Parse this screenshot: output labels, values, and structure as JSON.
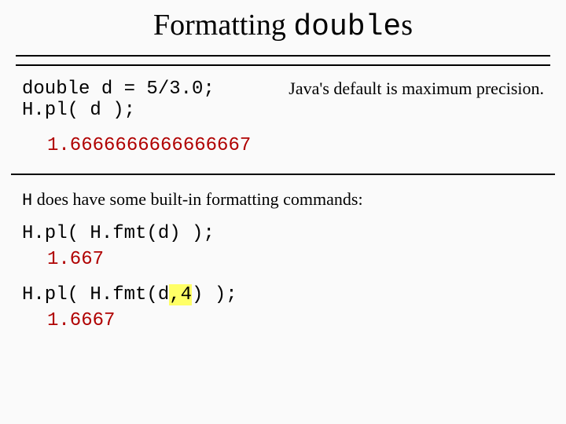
{
  "title": {
    "prefix": "Formatting ",
    "mono": "double",
    "suffix": "s"
  },
  "row1": {
    "code_line1": "double d = 5/3.0;",
    "code_line2": "H.pl( d );",
    "note": "Java's default is maximum precision."
  },
  "output1": "1.6666666666666667",
  "body_text": {
    "mono": "H",
    "rest": " does have some built-in formatting commands:"
  },
  "ex1": {
    "code": "H.pl( H.fmt(d) );",
    "out": "1.667"
  },
  "ex2": {
    "pre": "H.pl( H.fmt(d",
    "hl": ",4",
    "post": ") );",
    "out": "1.6667"
  }
}
